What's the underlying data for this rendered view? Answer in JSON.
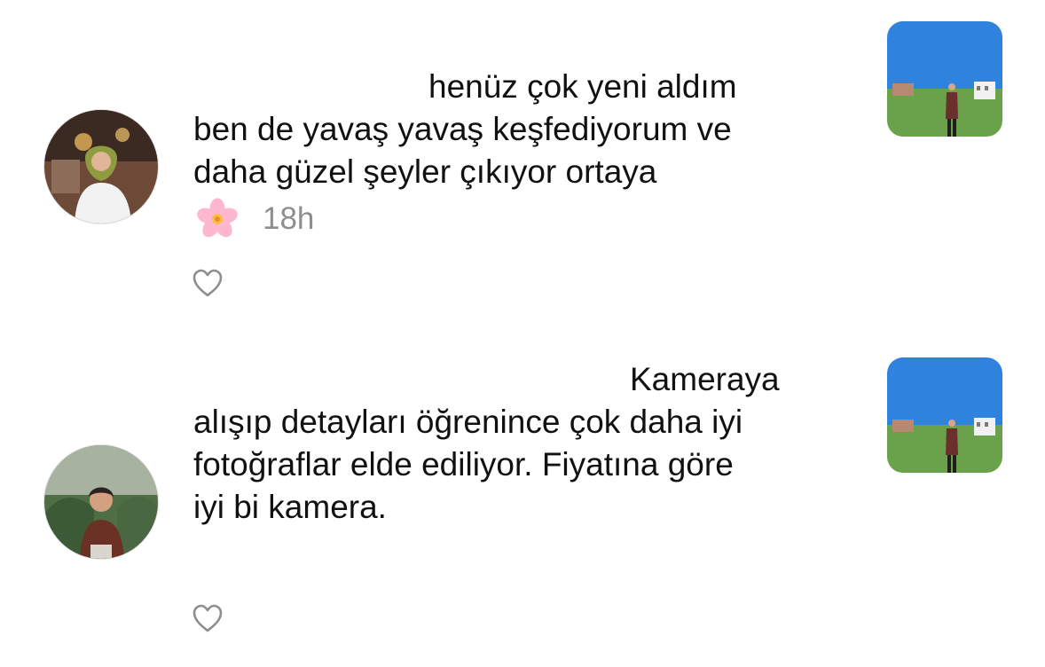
{
  "comments": [
    {
      "lines": [
        "henüz çok yeni aldım",
        "ben de yavaş yavaş keşfediyorum ve",
        "daha güzel şeyler çıkıyor ortaya"
      ],
      "emoji": "cherry-blossom",
      "time": "18h",
      "avatar_icon": "user-avatar",
      "thumbnail_icon": "photo-thumbnail",
      "like_icon": "heart-outline-icon"
    },
    {
      "lines": [
        "Kameraya",
        "alışıp detayları öğrenince çok daha iyi",
        "fotoğraflar elde ediliyor. Fiyatına göre",
        "iyi bi kamera."
      ],
      "avatar_icon": "user-avatar",
      "thumbnail_icon": "photo-thumbnail",
      "like_icon": "heart-outline-icon"
    }
  ],
  "colors": {
    "text": "#111111",
    "muted": "#8e8e8e",
    "background": "#ffffff"
  }
}
